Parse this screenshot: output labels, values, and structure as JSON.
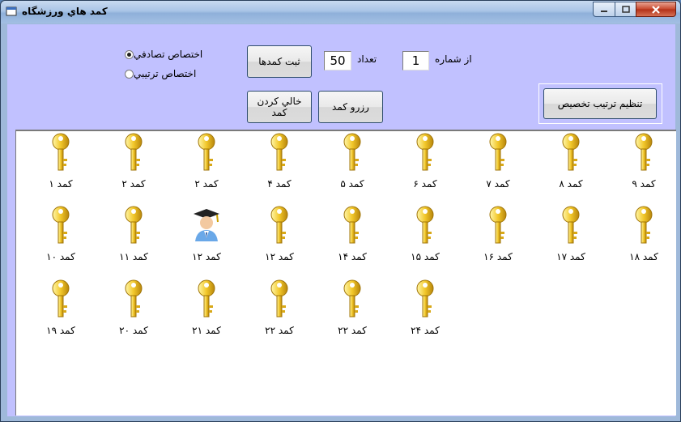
{
  "window": {
    "title": "كمد هاي ورزشگاه"
  },
  "options": {
    "random_label": "اختصاص تصادفي",
    "sequential_label": "اختصاص  ترتيبي",
    "selected": "random"
  },
  "buttons": {
    "register": "ثبت كمدها",
    "reserve": "رزرو كمد",
    "empty": "خالي كردن\nكمد",
    "arrange": "تنظيم ترتيب تخصيص"
  },
  "fields": {
    "count_label": "تعداد",
    "count_value": "50",
    "from_label": "از شماره",
    "from_value": "1"
  },
  "lockers": [
    {
      "label": "كمد ۱",
      "icon": "key-icon"
    },
    {
      "label": "كمد ۲",
      "icon": "key-icon"
    },
    {
      "label": "كمد ۲",
      "icon": "key-icon"
    },
    {
      "label": "كمد ۴",
      "icon": "key-icon"
    },
    {
      "label": "كمد ۵",
      "icon": "key-icon"
    },
    {
      "label": "كمد ۶",
      "icon": "key-icon"
    },
    {
      "label": "كمد ۷",
      "icon": "key-icon"
    },
    {
      "label": "كمد ۸",
      "icon": "key-icon"
    },
    {
      "label": "كمد ۹",
      "icon": "key-icon"
    },
    {
      "label": "كمد ۱۰",
      "icon": "key-icon"
    },
    {
      "label": "كمد ۱۱",
      "icon": "key-icon"
    },
    {
      "label": "كمد ۱۲",
      "icon": "student-icon"
    },
    {
      "label": "كمد ۱۲",
      "icon": "key-icon"
    },
    {
      "label": "كمد ۱۴",
      "icon": "key-icon"
    },
    {
      "label": "كمد ۱۵",
      "icon": "key-icon"
    },
    {
      "label": "كمد ۱۶",
      "icon": "key-icon"
    },
    {
      "label": "كمد ۱۷",
      "icon": "key-icon"
    },
    {
      "label": "كمد ۱۸",
      "icon": "key-icon"
    },
    {
      "label": "كمد ۱۹",
      "icon": "key-icon"
    },
    {
      "label": "كمد ۲۰",
      "icon": "key-icon"
    },
    {
      "label": "كمد ۲۱",
      "icon": "key-icon"
    },
    {
      "label": "كمد ۲۲",
      "icon": "key-icon"
    },
    {
      "label": "كمد ۲۲",
      "icon": "key-icon"
    },
    {
      "label": "كمد ۲۴",
      "icon": "key-icon"
    }
  ]
}
